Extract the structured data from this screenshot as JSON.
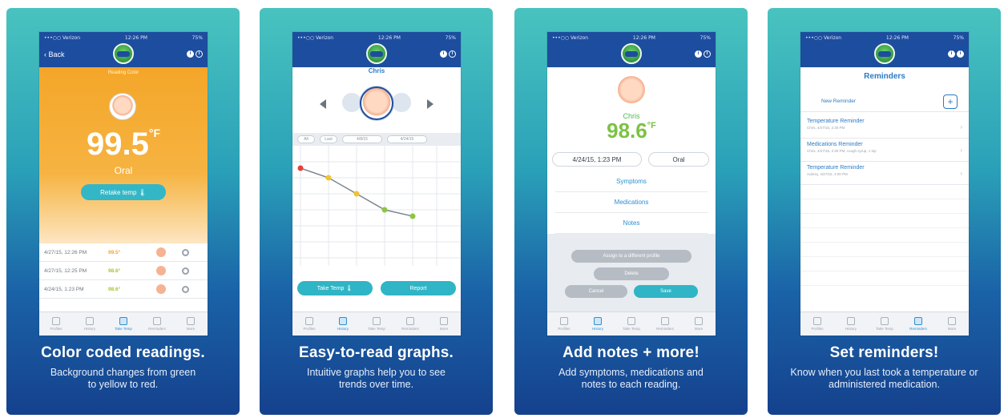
{
  "status": {
    "carrier": "•••○○ Verizon",
    "time": "12:26 PM",
    "battery": "75%"
  },
  "colors": {
    "navy": "#1d4d9e",
    "teal": "#33b7c6",
    "orange": "#f4a629",
    "green": "#7cc243"
  },
  "panels": [
    {
      "caption_title": "Color coded readings.",
      "caption_sub": "Background changes from green to yellow to red.",
      "back_label": "Back",
      "subtitle": "Reading Color",
      "temp_value": "99.5",
      "temp_unit": "°F",
      "method": "Oral",
      "retake_label": "Retake temp",
      "readings": [
        {
          "date": "4/27/15, 12:26 PM",
          "value": "99.5°"
        },
        {
          "date": "4/27/15, 12:25 PM",
          "value": "98.6°"
        },
        {
          "date": "4/24/15, 1:23 PM",
          "value": "98.6°"
        }
      ]
    },
    {
      "caption_title": "Easy-to-read graphs.",
      "caption_sub": "Intuitive graphs help you to see trends over time.",
      "name": "Chris",
      "filters": [
        "All",
        "Last",
        "4/8/15",
        "4/24/15"
      ],
      "take_temp_label": "Take Temp",
      "report_label": "Report"
    },
    {
      "caption_title": "Add notes + more!",
      "caption_sub": "Add symptoms, medications and notes to each reading.",
      "name": "Chris",
      "temp_value": "98.6",
      "temp_unit": "°F",
      "date": "4/24/15, 1:23 PM",
      "method": "Oral",
      "links": [
        "Symptoms",
        "Medications",
        "Notes"
      ],
      "assign_label": "Assign to a different profile",
      "delete_label": "Delete",
      "cancel_label": "Cancel",
      "save_label": "Save"
    },
    {
      "caption_title": "Set reminders!",
      "caption_sub": "Know when you last took a temperature or administered medication.",
      "title": "Reminders",
      "new_label": "New Reminder",
      "reminders": [
        {
          "title": "Temperature Reminder",
          "detail": "Chris, 4/27/15, 2:30 PM"
        },
        {
          "title": "Medications Reminder",
          "detail": "Chris, 4/27/15, 2:30 PM, cough syrup, 1 tsp"
        },
        {
          "title": "Temperature Reminder",
          "detail": "Aubrey, 4/27/15, 4:00 PM"
        }
      ]
    }
  ],
  "tabs": [
    "Profiles",
    "History",
    "Take Temp",
    "Reminders",
    "More"
  ]
}
